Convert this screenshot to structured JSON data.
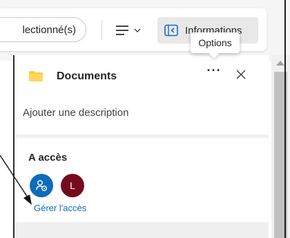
{
  "toolbar": {
    "selected_label": "lectionné(s)",
    "view_icon": "list-view-icon",
    "info_label": "Informations",
    "info_icon": "info-pane-icon"
  },
  "tooltip": {
    "text": "Options"
  },
  "pane": {
    "folder_icon": "folder-icon",
    "title": "Documents",
    "more_icon": "more-options-icon",
    "close_icon": "close-icon",
    "description_placeholder": "Ajouter une description",
    "access": {
      "title": "A accès",
      "share_icon": "people-share-icon",
      "user_initial": "L",
      "manage_link": "Gérer l'accès"
    }
  },
  "colors": {
    "accent": "#0f6cbd",
    "folder": "#ffc83d",
    "user_avatar": "#750b1c",
    "pane_background": "#f0f0f0"
  }
}
